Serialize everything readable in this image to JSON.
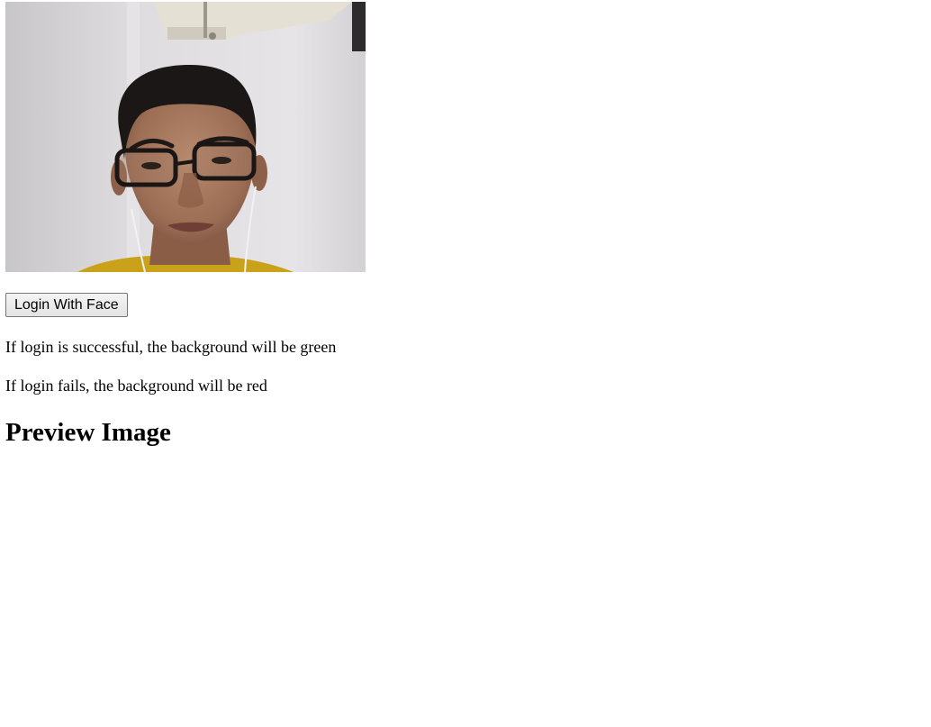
{
  "webcam": {
    "label": "webcam preview"
  },
  "controls": {
    "login_button_label": "Login With Face"
  },
  "messages": {
    "success_note": "If login is successful, the background will be green",
    "fail_note": "If login fails, the background will be red"
  },
  "preview": {
    "title": "Preview Image"
  }
}
